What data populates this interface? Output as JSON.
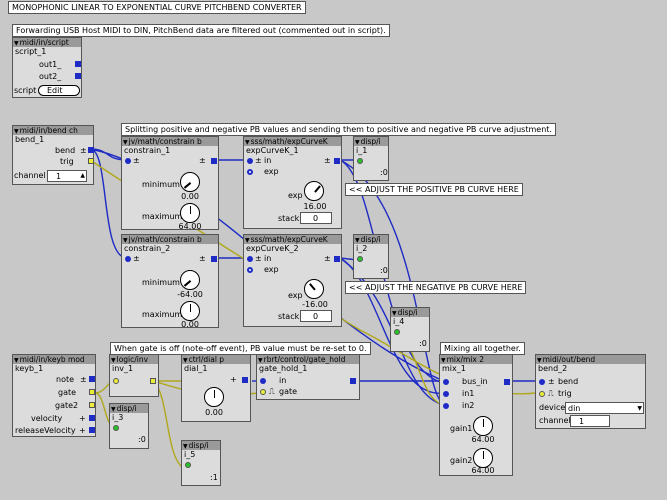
{
  "title": "MONOPHONIC LINEAR TO EXPONENTIAL CURVE PITCHBEND CONVERTER",
  "comments": {
    "forwarding": "Forwarding USB Host MIDI to DIN, PitchBend data are filtered out (commented out in script).",
    "splitting": "Splitting positive and negative PB values and sending them to positive and negative PB curve adjustment.",
    "adj_pos": "<< ADJUST THE POSITIVE PB CURVE HERE",
    "adj_neg": "<< ADJUST THE NEGATIVE PB CURVE HERE",
    "gate_off": "When gate is off (note-off event), PB value must be re-set to 0.",
    "mixing": "Mixing all together."
  },
  "script": {
    "type": "midi/in/script",
    "name": "script_1",
    "out1": "out1_",
    "out2": "out2_",
    "script_label": "script",
    "edit": "Edit"
  },
  "bend_in": {
    "type": "midi/in/bend ch",
    "name": "bend_1",
    "bend": "bend",
    "trig": "trig",
    "channel_label": "channel",
    "channel": "1"
  },
  "constrain1": {
    "type": "jv/math/constrain b",
    "name": "constrain_1",
    "min_label": "minimum",
    "min": "0.00",
    "max_label": "maximum",
    "max": "64.00"
  },
  "constrain2": {
    "type": "jv/math/constrain b",
    "name": "constrain_2",
    "min_label": "minimum",
    "min": "-64.00",
    "max_label": "maximum",
    "max": "0.00"
  },
  "exp1": {
    "type": "sss/math/expCurveK",
    "name": "expCurveK_1",
    "in": "in",
    "exp": "exp",
    "exp_val": "16.00",
    "stack_label": "stack",
    "stack": "0"
  },
  "exp2": {
    "type": "sss/math/expCurveK",
    "name": "expCurveK_2",
    "in": "in",
    "exp": "exp",
    "exp_val": "-16.00",
    "stack_label": "stack",
    "stack": "0"
  },
  "disp1": {
    "type": "disp/i",
    "name": "i_1",
    "value": ":0"
  },
  "disp2": {
    "type": "disp/i",
    "name": "i_2",
    "value": ":0"
  },
  "disp3": {
    "type": "disp/i",
    "name": "i_3",
    "value": ":0"
  },
  "disp4": {
    "type": "disp/i",
    "name": "i_4",
    "value": ":0"
  },
  "disp5": {
    "type": "disp/i",
    "name": "i_5",
    "value": ":1"
  },
  "keyb": {
    "type": "midi/in/keyb mod",
    "name": "keyb_1",
    "note": "note",
    "gate": "gate",
    "gate2": "gate2",
    "velocity": "velocity",
    "releaseVelocity": "releaseVelocity"
  },
  "logic": {
    "type": "logic/inv",
    "name": "inv_1"
  },
  "dial": {
    "type": "ctrl/dial p",
    "name": "dial_1",
    "value": "0.00"
  },
  "gatehold": {
    "type": "rbrt/control/gate_hold",
    "name": "gate_hold_1",
    "in": "in",
    "gate": "gate"
  },
  "mix": {
    "type": "mix/mix 2",
    "name": "mix_1",
    "bus_in": "bus_in",
    "in1": "in1",
    "in2": "in2",
    "gain1_label": "gain1",
    "gain1": "64.00",
    "gain2_label": "gain2",
    "gain2": "64.00"
  },
  "bend_out": {
    "type": "midi/out/bend",
    "name": "bend_2",
    "bend": "bend",
    "trig": "trig",
    "device_label": "device",
    "device": "din",
    "channel_label": "channel",
    "channel": "1"
  }
}
